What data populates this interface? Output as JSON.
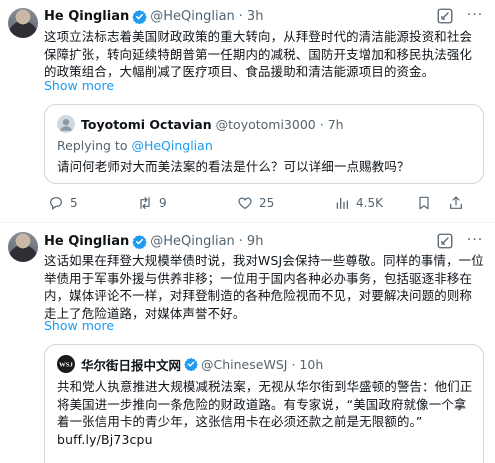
{
  "tweets": [
    {
      "author": {
        "name": "He Qinglian",
        "handle": "@HeQinglian"
      },
      "separator": "·",
      "time": "3h",
      "text": "这项立法标志着美国财政政策的重大转向，从拜登时代的清洁能源投资和社会保障扩张，转向延续特朗普第一任期内的减税、国防开支增加和移民执法强化的政策组合，大幅削减了医疗项目、食品援助和清洁能源项目的资金。",
      "show_more": "Show more",
      "quote": {
        "author": {
          "name": "Toyotomi Octavian",
          "handle": "@toyotomi3000"
        },
        "separator": "·",
        "time": "7h",
        "replying_prefix": "Replying to ",
        "replying_to": "@HeQinglian",
        "text": "请问何老师对大而美法案的看法是什么？可以详细一点赐教吗？"
      },
      "stats": {
        "replies": "5",
        "reposts": "9",
        "likes": "25",
        "views": "4.5K"
      }
    },
    {
      "author": {
        "name": "He Qinglian",
        "handle": "@HeQinglian"
      },
      "separator": "·",
      "time": "9h",
      "text": "这话如果在拜登大规模举债时说，我对WSJ会保持一些尊敬。同样的事情，一位举债用于军事外援与供养非移；一位用于国内各种必办事务，包括驱逐非移在内，媒体评论不一样，对拜登制造的各种危险视而不见，对要解决问题的则称走上了危险道路，对媒体声誉不好。",
      "show_more": "Show more",
      "quote": {
        "author": {
          "name": "华尔街日报中文网",
          "handle": "@ChineseWSJ"
        },
        "avatar_text": "WSJ",
        "separator": "·",
        "time": "10h",
        "text": "共和党人执意推进大规模减税法案，无视从华尔街到华盛顿的警告：他们正将美国进一步推向一条危险的财政道路。有专家说，“美国政府就像一个拿着一张信用卡的青少年，这张信用卡在必须还款之前是无限额的。”",
        "link": "buff.ly/Bj73cpu"
      }
    }
  ],
  "colors": {
    "accent": "#1d9bf0",
    "text_primary": "#0f1419",
    "text_secondary": "#536471",
    "border": "#cfd9de"
  },
  "icons": [
    "verified-badge-icon",
    "grok-icon",
    "more-icon",
    "reply-icon",
    "repost-icon",
    "like-icon",
    "views-icon",
    "bookmark-icon",
    "share-icon"
  ]
}
